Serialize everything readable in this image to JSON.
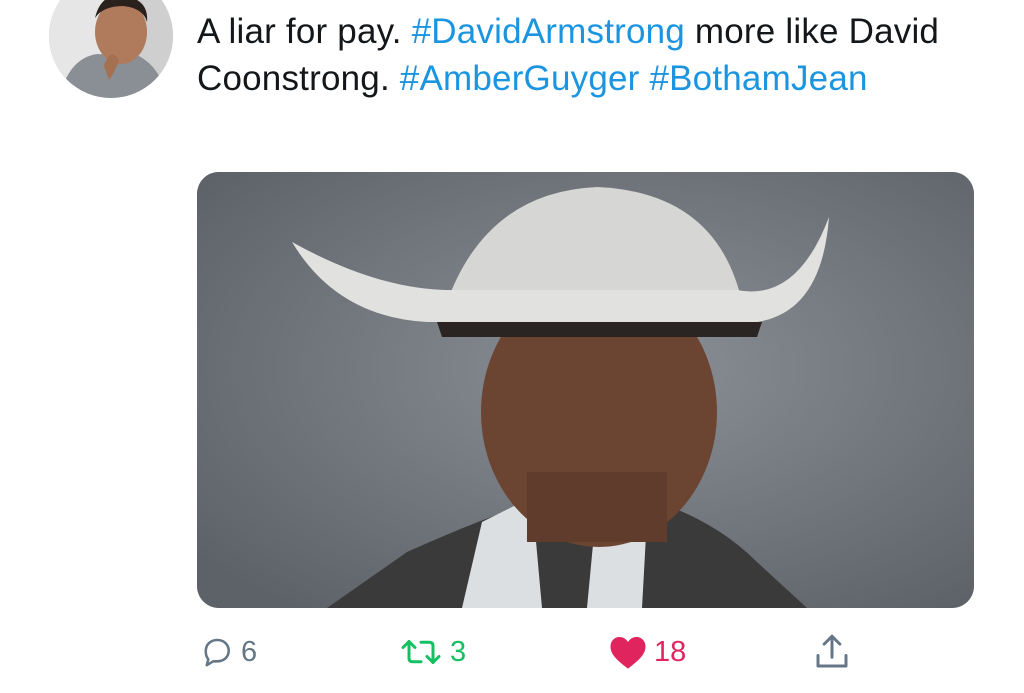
{
  "tweet": {
    "text_segments": [
      {
        "text": "A liar for pay. ",
        "type": "text"
      },
      {
        "text": "#DavidArmstrong",
        "type": "hashtag"
      },
      {
        "text": " more like David Coonstrong. ",
        "type": "text"
      },
      {
        "text": "#AmberGuyger",
        "type": "hashtag"
      },
      {
        "text": " ",
        "type": "text"
      },
      {
        "text": "#BothamJean",
        "type": "hashtag"
      }
    ]
  },
  "actions": {
    "reply": {
      "icon": "reply-icon",
      "count": "6"
    },
    "retweet": {
      "icon": "retweet-icon",
      "count": "3"
    },
    "like": {
      "icon": "heart-icon",
      "count": "18",
      "liked": true
    },
    "share": {
      "icon": "share-icon"
    }
  },
  "colors": {
    "hashtag": "#1b95e0",
    "muted": "#657786",
    "retweet": "#17bf63",
    "like": "#e0245e",
    "text": "#14171a"
  }
}
